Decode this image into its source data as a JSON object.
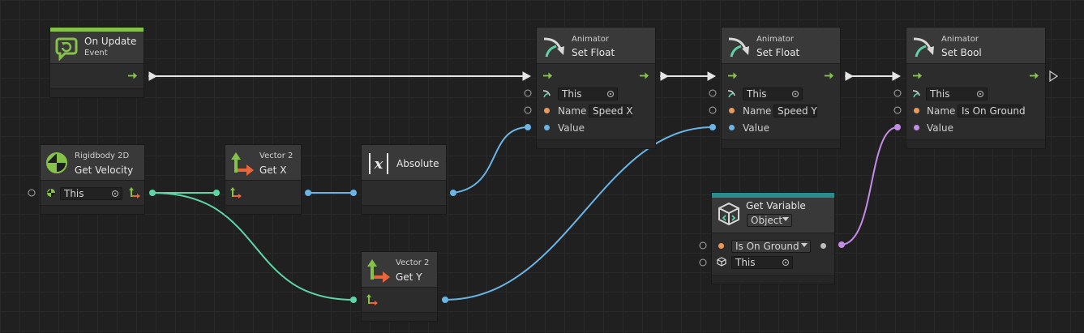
{
  "colors": {
    "flow": "#e6e6e6",
    "float": "#6ab4e6",
    "vector2": "#5fd4a6",
    "bool": "#c68be6",
    "string": "#e89a5c",
    "event_accent": "#86c24a",
    "variable_accent": "#2a8c8c"
  },
  "nodes": {
    "on_update": {
      "title": "On Update",
      "subtitle": "Event",
      "icon": "refresh-bubble-icon"
    },
    "rb_get_velocity": {
      "category": "Rigidbody 2D",
      "title": "Get Velocity",
      "target": "This",
      "icon": "rigidbody-icon"
    },
    "v2_get_x": {
      "category": "Vector 2",
      "title": "Get X",
      "icon": "vector2-icon"
    },
    "absolute": {
      "title": "Absolute",
      "icon": "abs-x-icon"
    },
    "v2_get_y": {
      "category": "Vector 2",
      "title": "Get Y",
      "icon": "vector2-icon"
    },
    "set_float_x": {
      "category": "Animator",
      "title": "Set Float",
      "target": "This",
      "name_label": "Name",
      "name_value": "Speed X",
      "value_label": "Value"
    },
    "set_float_y": {
      "category": "Animator",
      "title": "Set Float",
      "target": "This",
      "name_label": "Name",
      "name_value": "Speed Y",
      "value_label": "Value"
    },
    "set_bool": {
      "category": "Animator",
      "title": "Set Bool",
      "target": "This",
      "name_label": "Name",
      "name_value": "Is On Ground",
      "value_label": "Value"
    },
    "get_variable": {
      "title": "Get Variable",
      "kind": "Object",
      "variable": "Is On Ground",
      "target": "This",
      "icon": "cube-icon"
    }
  }
}
